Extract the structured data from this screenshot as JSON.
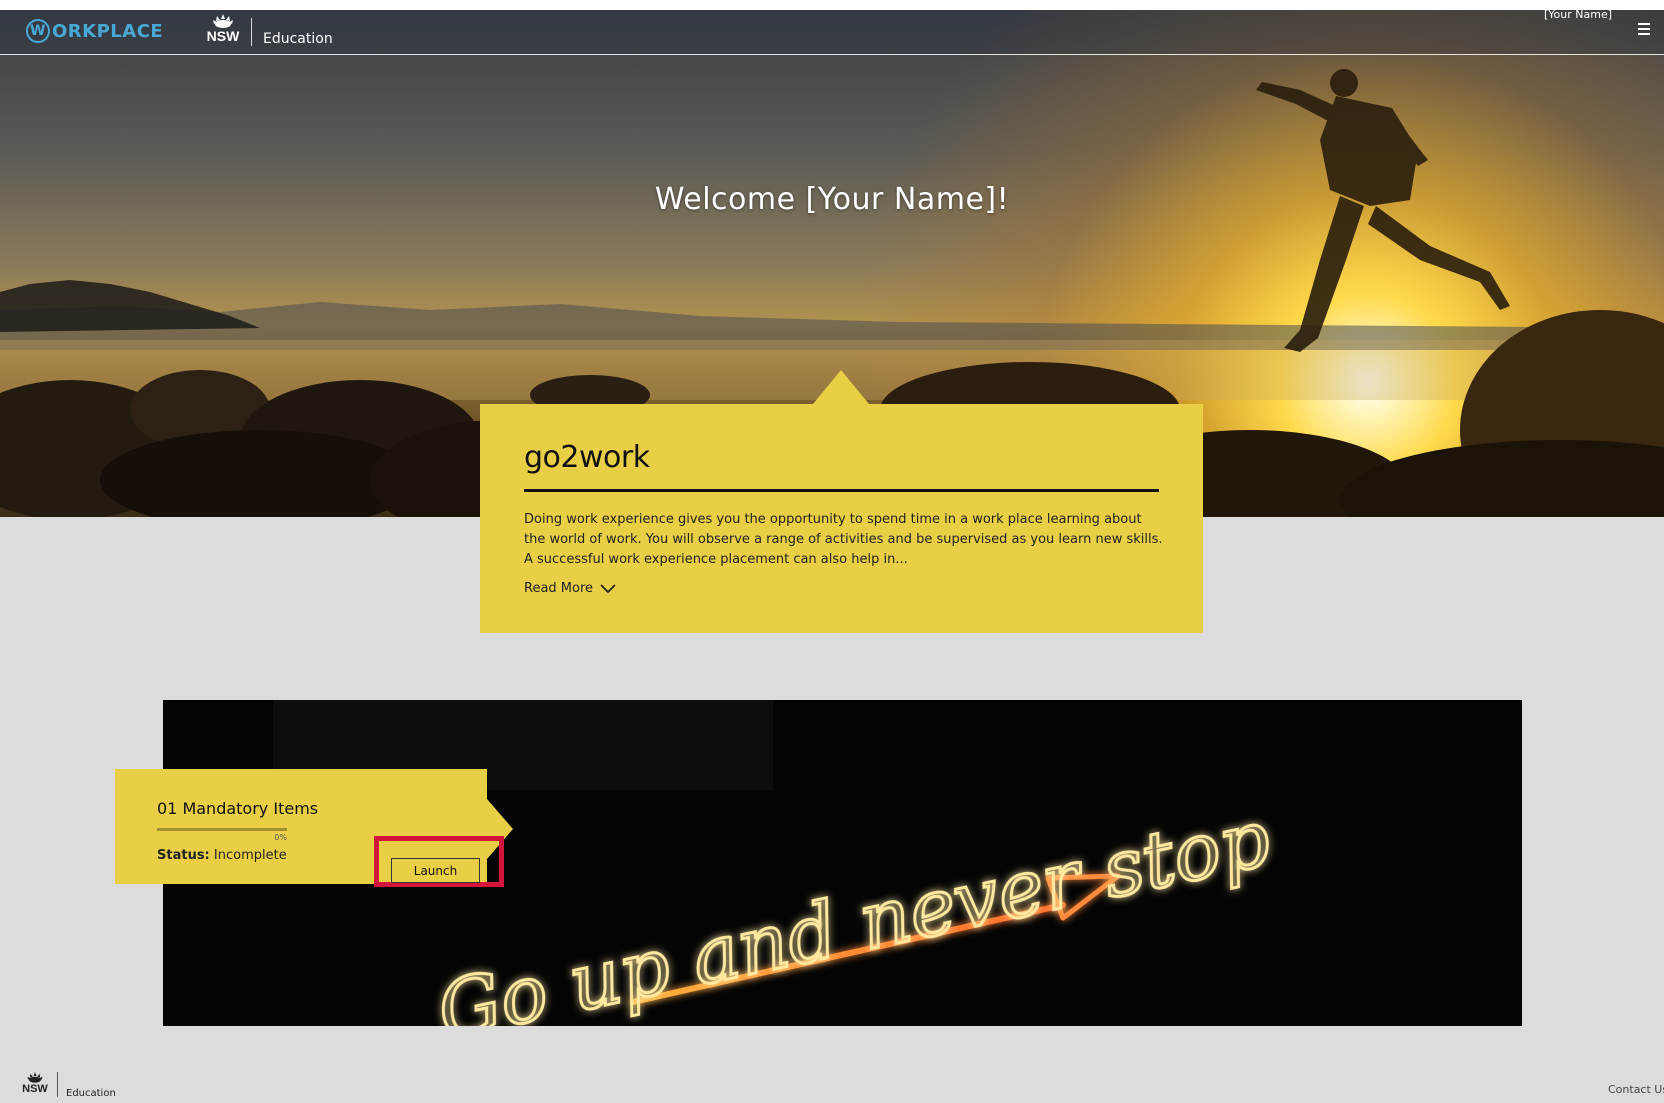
{
  "header": {
    "brand_name": "ORKPLACE",
    "brand_initial": "W",
    "nsw_label": "NSW",
    "department": "Education",
    "user_name": "[Your Name]",
    "menu_icon": "hamburger-menu-icon"
  },
  "hero": {
    "welcome": "Welcome [Your Name]!"
  },
  "intro": {
    "title": "go2work",
    "text": "Doing work experience gives you the opportunity to spend time in a work place learning about the world of work. You will observe a range of activities and be supervised as you learn new skills. A successful work experience placement can also help in...",
    "read_more": "Read More",
    "read_more_icon": "chevron-down-icon"
  },
  "module": {
    "title": "01 Mandatory Items",
    "progress_percent": 0,
    "progress_label": "0%",
    "status_label": "Status:",
    "status_value": "Incomplete",
    "launch_label": "Launch",
    "banner_text": "Go up and never stop"
  },
  "footer": {
    "nsw_label": "NSW",
    "department": "Education",
    "contact_label": "Contact Us"
  },
  "colors": {
    "card_yellow": "#e8cf46",
    "highlight_red": "#d3143b",
    "page_gray": "#dcdcdc",
    "brand_blue": "#49a9d6"
  }
}
